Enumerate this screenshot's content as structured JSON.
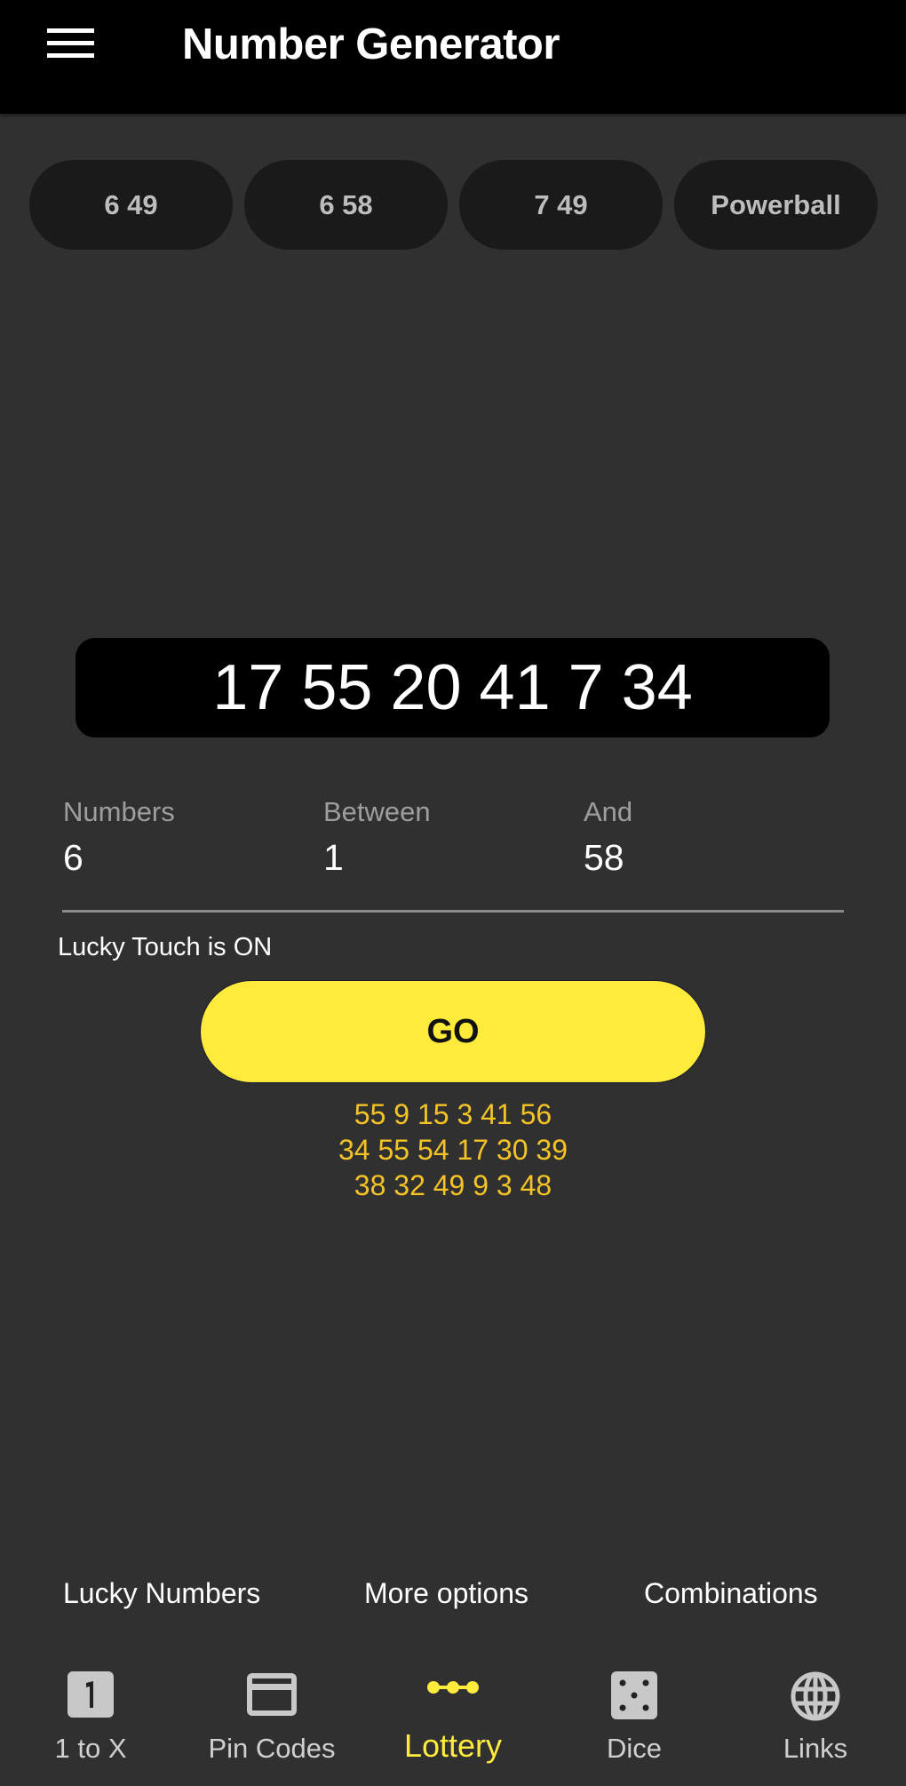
{
  "header": {
    "title": "Number Generator",
    "menu_icon": "hamburger-menu-icon"
  },
  "presets": [
    {
      "label": "6 49"
    },
    {
      "label": "6 58"
    },
    {
      "label": "7 49"
    },
    {
      "label": "Powerball"
    }
  ],
  "result": "17 55 20 41 7 34",
  "fields": [
    {
      "label": "Numbers",
      "value": "6"
    },
    {
      "label": "Between",
      "value": "1"
    },
    {
      "label": "And",
      "value": "58"
    }
  ],
  "lucky_touch_status": "Lucky Touch is ON",
  "go_label": "GO",
  "history": [
    "55 9 15 3 41 56",
    "34 55 54 17 30 39",
    "38 32 49 9 3 48"
  ],
  "bottom_links": [
    {
      "label": "Lucky Numbers"
    },
    {
      "label": "More options"
    },
    {
      "label": "Combinations"
    }
  ],
  "nav": {
    "active": "Lottery",
    "items": [
      {
        "label": "1 to X",
        "icon": "number-one-icon"
      },
      {
        "label": "Pin Codes",
        "icon": "card-icon"
      },
      {
        "label": "Lottery",
        "icon": "lottery-dots-icon"
      },
      {
        "label": "Dice",
        "icon": "dice-icon"
      },
      {
        "label": "Links",
        "icon": "globe-icon"
      }
    ]
  },
  "colors": {
    "accent": "#ffeb3b",
    "history_text": "#f5c326",
    "background": "#303030",
    "appbar": "#000000",
    "chip": "#1a1a1a"
  }
}
